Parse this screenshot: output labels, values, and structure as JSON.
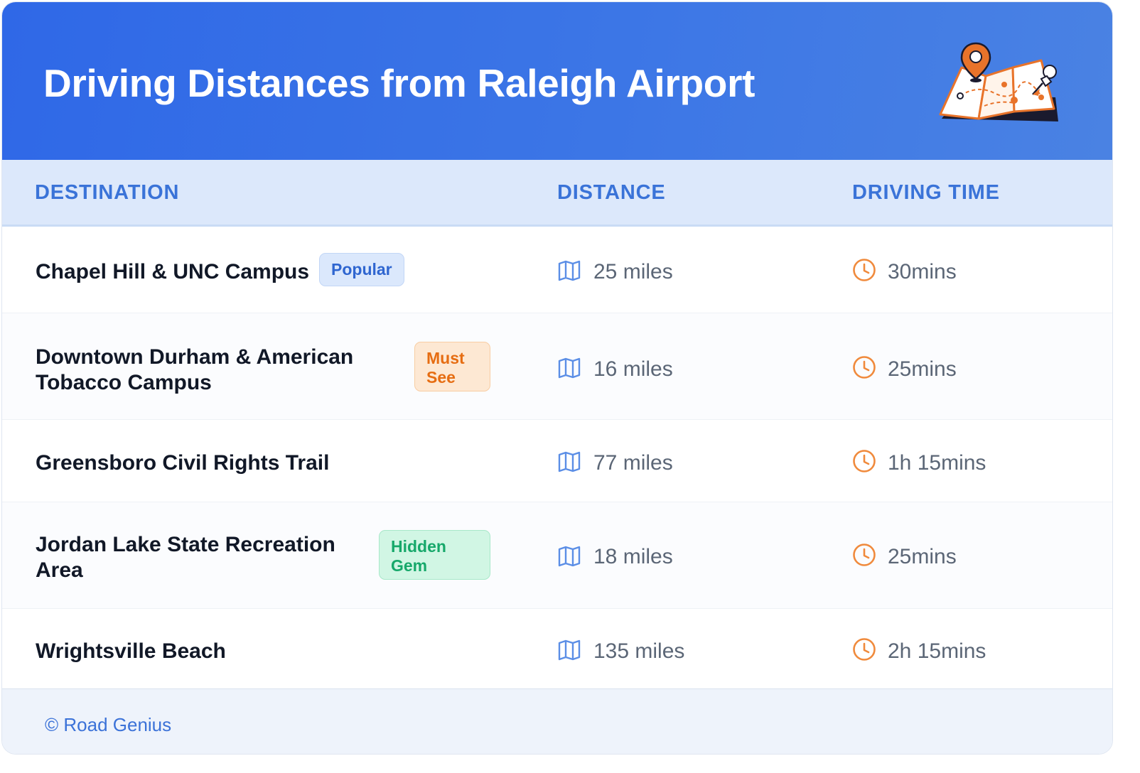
{
  "header": {
    "title": "Driving Distances from Raleigh Airport",
    "illustration": "map-with-pins-illustration"
  },
  "columns": {
    "destination": "DESTINATION",
    "distance": "DISTANCE",
    "driving_time": "DRIVING TIME"
  },
  "icons": {
    "distance": "map-icon",
    "time": "clock-icon"
  },
  "colors": {
    "header_start": "#2f68e7",
    "header_end": "#4a82e3",
    "accent_blue": "#3a73d8",
    "clock_orange": "#f08a3c",
    "map_blue": "#5b8ee6"
  },
  "rows": [
    {
      "destination": "Chapel Hill & UNC Campus",
      "badge": "Popular",
      "distance": "25 miles",
      "time": "30mins"
    },
    {
      "destination_line1": "Downtown Durham & American",
      "destination_line2": "Tobacco Campus",
      "badge_line1": "Must",
      "badge_line2": "See",
      "distance": "16 miles",
      "time": "25mins"
    },
    {
      "destination": "Greensboro Civil Rights Trail",
      "distance": "77 miles",
      "time": "1h 15mins"
    },
    {
      "destination_line1": "Jordan Lake State Recreation",
      "destination_line2": "Area",
      "badge_line1": "Hidden",
      "badge_line2": "Gem",
      "distance": "18 miles",
      "time": "25mins"
    },
    {
      "destination": "Wrightsville Beach",
      "distance": "135 miles",
      "time": "2h 15mins"
    }
  ],
  "footer": {
    "copyright": "© Road Genius"
  }
}
